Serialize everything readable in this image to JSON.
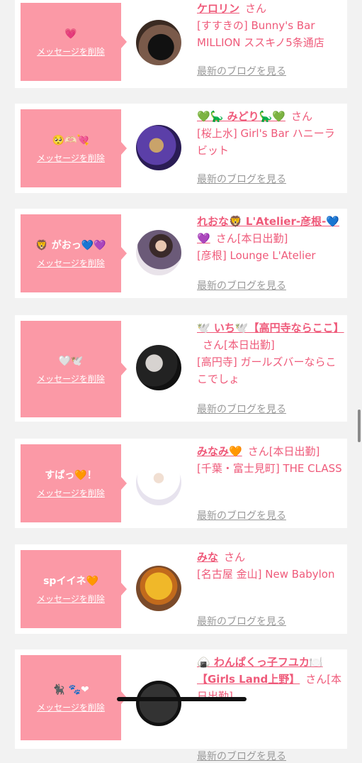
{
  "delete_label": "メッセージを削除",
  "blog_label": "最新のブログを見る",
  "san_label": "さん",
  "colors": {
    "bubble": "#fb99a6",
    "accent": "#ef5a7a",
    "link_gray": "#999999",
    "background": "#f2f2f2"
  },
  "messages": [
    {
      "message": "💗",
      "name": "ケロリン",
      "status": "",
      "shop": "[すすきの] Bunny's Bar MILLION ススキノ5条通店",
      "avatar_icon": "black-heart-photo"
    },
    {
      "message": "🥺🫶🏻💘",
      "name": "💚🦕 みどり🦕💚",
      "status": "",
      "shop": "[桜上水] Girl's Bar ハニーラビット",
      "avatar_icon": "stage-light-photo"
    },
    {
      "message": "🦁 がおっ💙💜",
      "name": "れおな🦁 L'Atelier-彦根-💙💜",
      "status": "[本日出勤]",
      "shop": "[彦根] Lounge L'Atelier",
      "avatar_icon": "purple-dress-photo"
    },
    {
      "message": "🤍🕊️",
      "name": "🕊️ いち🕊️【高円寺ならここ】",
      "status": "[本日出勤]",
      "shop": "[高円寺] ガールズバーならここでしょ",
      "avatar_icon": "peace-sign-photo"
    },
    {
      "message": "すぱっ🧡！",
      "name": "みなみ🧡",
      "status": "[本日出勤]",
      "shop": "[千葉・富士見町] THE CLASS",
      "avatar_icon": "white-dress-photo"
    },
    {
      "message": "spイイネ🧡",
      "name": "みな",
      "status": "",
      "shop": "[名古屋 金山] New Babylon",
      "avatar_icon": "bear-plush-photo"
    },
    {
      "message": "🐈‍⬛ 🐾❤",
      "name": "🍙 わんぱくっ子フユカ🍽️【Girls Land上野】",
      "status": "[本日出勤]",
      "shop": "",
      "avatar_icon": "dark-photo"
    }
  ]
}
